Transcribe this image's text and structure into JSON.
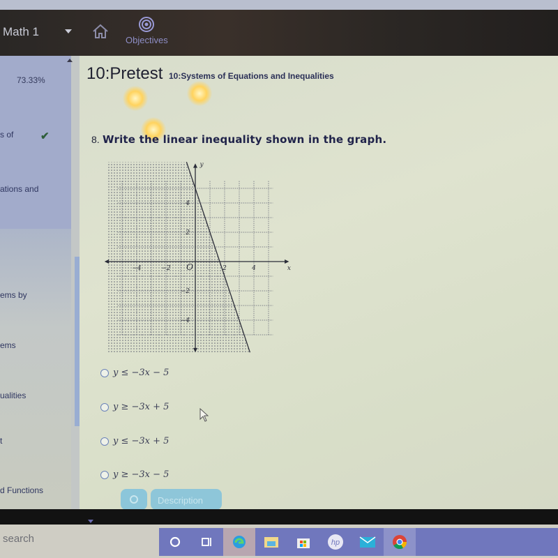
{
  "nav": {
    "course": "Math 1",
    "home_icon": "home-icon",
    "objectives_label": "Objectives",
    "objectives_icon": "target-icon"
  },
  "sidebar": {
    "progress": "73.33%",
    "items": [
      {
        "label": "s of",
        "completed": true
      },
      {
        "label": "ations and"
      },
      {
        "label": "ems by"
      },
      {
        "label": "ems"
      },
      {
        "label": "ualities"
      },
      {
        "label": "t"
      },
      {
        "label": "d Functions"
      }
    ]
  },
  "page": {
    "title": "10:Pretest",
    "subtitle": "10:Systems of Equations and Inequalities"
  },
  "question": {
    "number": "8.",
    "text": "Write the linear inequality shown in the graph.",
    "options": [
      {
        "label": "y ≤ −3x − 5",
        "selected": false
      },
      {
        "label": "y ≥ −3x + 5",
        "selected": false
      },
      {
        "label": "y ≤ −3x + 5",
        "selected": false
      },
      {
        "label": "y ≥ −3x − 5",
        "selected": false
      }
    ]
  },
  "graph": {
    "x_axis_label": "x",
    "y_axis_label": "y",
    "origin_label": "O",
    "x_ticks": [
      "−4",
      "−2",
      "2",
      "4"
    ],
    "y_ticks": [
      "4",
      "2",
      "−2",
      "−4"
    ],
    "x_range": [
      -6,
      6
    ],
    "y_range": [
      -6,
      6
    ],
    "line": {
      "slope": -3,
      "intercept": 5,
      "style": "solid"
    },
    "shaded": "below-left"
  },
  "buttons": {
    "timer_icon": "clock-icon",
    "description": "Description"
  },
  "taskbar": {
    "search_placeholder": "search",
    "apps": [
      "cortana-icon",
      "task-view-icon",
      "edge-icon",
      "file-explorer-icon",
      "store-icon",
      "hp-icon",
      "mail-icon",
      "chrome-icon"
    ]
  }
}
